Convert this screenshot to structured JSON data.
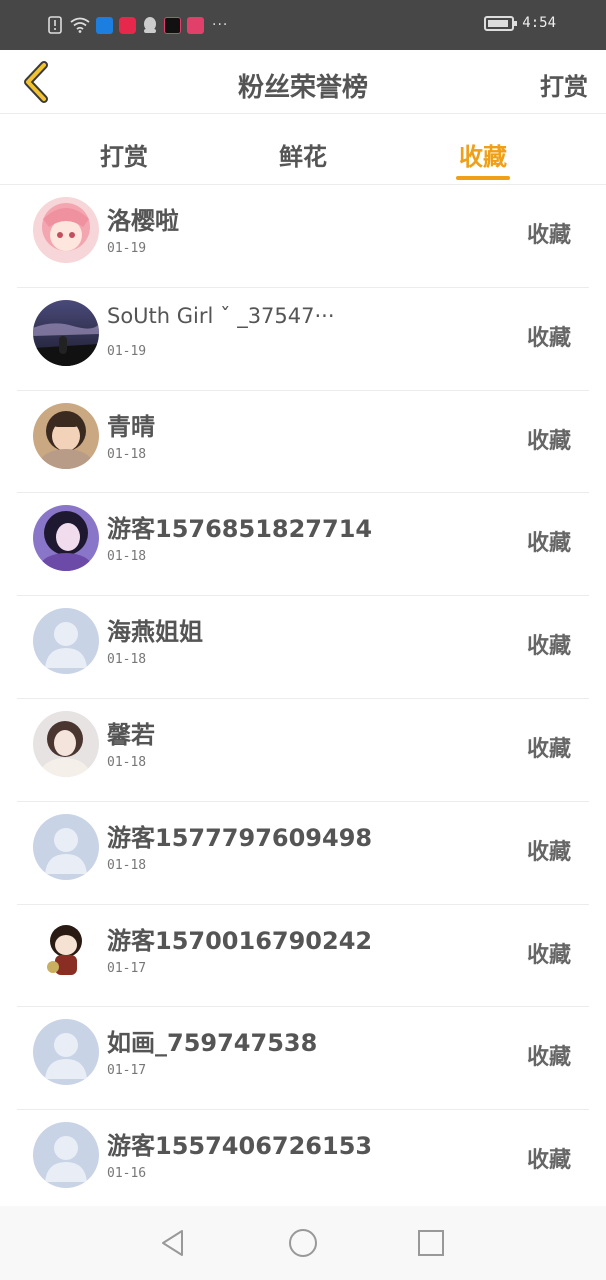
{
  "status_bar": {
    "time": "4:54",
    "icons": [
      "alert-icon",
      "wifi-icon",
      "shield-app-icon",
      "video-app-icon",
      "qq-icon",
      "tiktok-icon",
      "calendar-app-icon"
    ],
    "more": "···"
  },
  "header": {
    "title": "粉丝荣誉榜",
    "action": "打赏"
  },
  "tabs": [
    {
      "label": "打赏",
      "active": false
    },
    {
      "label": "鲜花",
      "active": false
    },
    {
      "label": "收藏",
      "active": true
    }
  ],
  "fans": [
    {
      "name": "洛樱啦",
      "date": "01-19",
      "action": "收藏",
      "avatar": "anime-girl-avatar"
    },
    {
      "name": "SoUth Girl ˇ _37547···",
      "date": "01-19",
      "action": "收藏",
      "avatar": "night-sky-avatar"
    },
    {
      "name": "青晴",
      "date": "01-18",
      "action": "收藏",
      "avatar": "child-photo-avatar"
    },
    {
      "name": "游客1576851827714",
      "date": "01-18",
      "action": "收藏",
      "avatar": "girl-purple-avatar"
    },
    {
      "name": "海燕姐姐",
      "date": "01-18",
      "action": "收藏",
      "avatar": "default-avatar"
    },
    {
      "name": "馨若",
      "date": "01-18",
      "action": "收藏",
      "avatar": "girl-winter-avatar"
    },
    {
      "name": "游客1577797609498",
      "date": "01-18",
      "action": "收藏",
      "avatar": "default-avatar"
    },
    {
      "name": "游客1570016790242",
      "date": "01-17",
      "action": "收藏",
      "avatar": "chibi-character-avatar"
    },
    {
      "name": "如画_759747538",
      "date": "01-17",
      "action": "收藏",
      "avatar": "default-avatar"
    },
    {
      "name": "游客1557406726153",
      "date": "01-16",
      "action": "收藏",
      "avatar": "default-avatar"
    }
  ],
  "colors": {
    "accent": "#f0a018",
    "status_bar": "#474747",
    "text": "#555555",
    "default_avatar": "#c8d3e6"
  },
  "nav": [
    "back-nav-icon",
    "home-nav-icon",
    "recents-nav-icon"
  ]
}
